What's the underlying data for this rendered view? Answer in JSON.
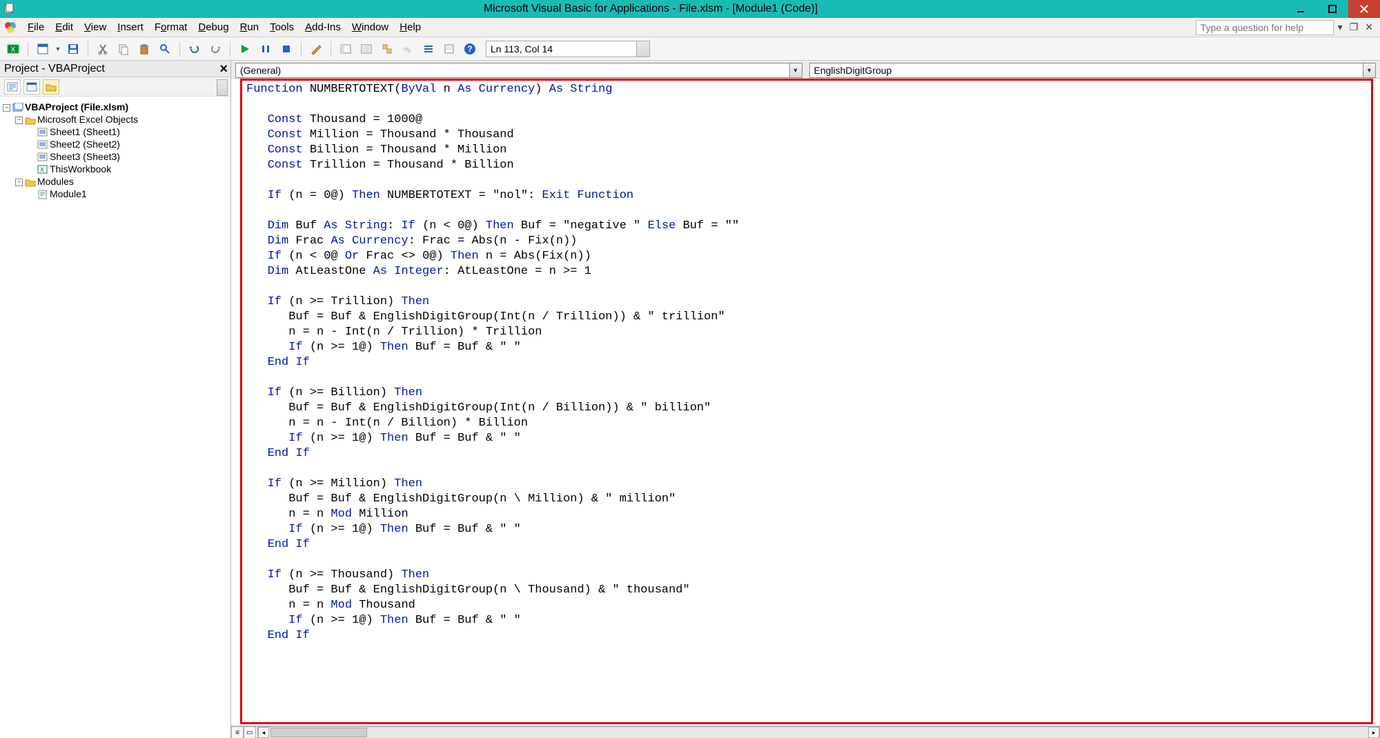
{
  "title": "Microsoft Visual Basic for Applications - File.xlsm - [Module1 (Code)]",
  "menus": {
    "file": "File",
    "edit": "Edit",
    "view": "View",
    "insert": "Insert",
    "format": "Format",
    "debug": "Debug",
    "run": "Run",
    "tools": "Tools",
    "addins": "Add-Ins",
    "window": "Window",
    "help": "Help"
  },
  "help_placeholder": "Type a question for help",
  "cursor_pos": "Ln 113, Col 14",
  "project_header": "Project - VBAProject",
  "tree": {
    "root": "VBAProject (File.xlsm)",
    "excel_objects": "Microsoft Excel Objects",
    "sheets": [
      "Sheet1 (Sheet1)",
      "Sheet2 (Sheet2)",
      "Sheet3 (Sheet3)"
    ],
    "thiswb": "ThisWorkbook",
    "modules_folder": "Modules",
    "module": "Module1"
  },
  "dropdown_left": "(General)",
  "dropdown_right": "EnglishDigitGroup",
  "code_tokens": [
    [
      {
        "t": "Function",
        "k": 1
      },
      {
        "t": " NUMBERTOTEXT("
      },
      {
        "t": "ByVal",
        "k": 1
      },
      {
        "t": " n "
      },
      {
        "t": "As Currency",
        "k": 1
      },
      {
        "t": ") "
      },
      {
        "t": "As String",
        "k": 1
      }
    ],
    [],
    [
      {
        "t": "   "
      },
      {
        "t": "Const",
        "k": 1
      },
      {
        "t": " Thousand = 1000@"
      }
    ],
    [
      {
        "t": "   "
      },
      {
        "t": "Const",
        "k": 1
      },
      {
        "t": " Million = Thousand * Thousand"
      }
    ],
    [
      {
        "t": "   "
      },
      {
        "t": "Const",
        "k": 1
      },
      {
        "t": " Billion = Thousand * Million"
      }
    ],
    [
      {
        "t": "   "
      },
      {
        "t": "Const",
        "k": 1
      },
      {
        "t": " Trillion = Thousand * Billion"
      }
    ],
    [],
    [
      {
        "t": "   "
      },
      {
        "t": "If",
        "k": 1
      },
      {
        "t": " (n = 0@) "
      },
      {
        "t": "Then",
        "k": 1
      },
      {
        "t": " NUMBERTOTEXT = \"nol\": "
      },
      {
        "t": "Exit Function",
        "k": 1
      }
    ],
    [],
    [
      {
        "t": "   "
      },
      {
        "t": "Dim",
        "k": 1
      },
      {
        "t": " Buf "
      },
      {
        "t": "As String",
        "k": 1
      },
      {
        "t": ": "
      },
      {
        "t": "If",
        "k": 1
      },
      {
        "t": " (n < 0@) "
      },
      {
        "t": "Then",
        "k": 1
      },
      {
        "t": " Buf = \"negative \" "
      },
      {
        "t": "Else",
        "k": 1
      },
      {
        "t": " Buf = \"\""
      }
    ],
    [
      {
        "t": "   "
      },
      {
        "t": "Dim",
        "k": 1
      },
      {
        "t": " Frac "
      },
      {
        "t": "As Currency",
        "k": 1
      },
      {
        "t": ": Frac = Abs(n - Fix(n))"
      }
    ],
    [
      {
        "t": "   "
      },
      {
        "t": "If",
        "k": 1
      },
      {
        "t": " (n < 0@ "
      },
      {
        "t": "Or",
        "k": 1
      },
      {
        "t": " Frac <> 0@) "
      },
      {
        "t": "Then",
        "k": 1
      },
      {
        "t": " n = Abs(Fix(n))"
      }
    ],
    [
      {
        "t": "   "
      },
      {
        "t": "Dim",
        "k": 1
      },
      {
        "t": " AtLeastOne "
      },
      {
        "t": "As Integer",
        "k": 1
      },
      {
        "t": ": AtLeastOne = n >= 1"
      }
    ],
    [],
    [
      {
        "t": "   "
      },
      {
        "t": "If",
        "k": 1
      },
      {
        "t": " (n >= Trillion) "
      },
      {
        "t": "Then",
        "k": 1
      }
    ],
    [
      {
        "t": "      Buf = Buf & EnglishDigitGroup(Int(n / Trillion)) & \" trillion\""
      }
    ],
    [
      {
        "t": "      n = n - Int(n / Trillion) * Trillion"
      }
    ],
    [
      {
        "t": "      "
      },
      {
        "t": "If",
        "k": 1
      },
      {
        "t": " (n >= 1@) "
      },
      {
        "t": "Then",
        "k": 1
      },
      {
        "t": " Buf = Buf & \" \""
      }
    ],
    [
      {
        "t": "   "
      },
      {
        "t": "End If",
        "k": 1
      }
    ],
    [],
    [
      {
        "t": "   "
      },
      {
        "t": "If",
        "k": 1
      },
      {
        "t": " (n >= Billion) "
      },
      {
        "t": "Then",
        "k": 1
      }
    ],
    [
      {
        "t": "      Buf = Buf & EnglishDigitGroup(Int(n / Billion)) & \" billion\""
      }
    ],
    [
      {
        "t": "      n = n - Int(n / Billion) * Billion"
      }
    ],
    [
      {
        "t": "      "
      },
      {
        "t": "If",
        "k": 1
      },
      {
        "t": " (n >= 1@) "
      },
      {
        "t": "Then",
        "k": 1
      },
      {
        "t": " Buf = Buf & \" \""
      }
    ],
    [
      {
        "t": "   "
      },
      {
        "t": "End If",
        "k": 1
      }
    ],
    [],
    [
      {
        "t": "   "
      },
      {
        "t": "If",
        "k": 1
      },
      {
        "t": " (n >= Million) "
      },
      {
        "t": "Then",
        "k": 1
      }
    ],
    [
      {
        "t": "      Buf = Buf & EnglishDigitGroup(n \\ Million) & \" million\""
      }
    ],
    [
      {
        "t": "      n = n "
      },
      {
        "t": "Mod",
        "k": 1
      },
      {
        "t": " Million"
      }
    ],
    [
      {
        "t": "      "
      },
      {
        "t": "If",
        "k": 1
      },
      {
        "t": " (n >= 1@) "
      },
      {
        "t": "Then",
        "k": 1
      },
      {
        "t": " Buf = Buf & \" \""
      }
    ],
    [
      {
        "t": "   "
      },
      {
        "t": "End If",
        "k": 1
      }
    ],
    [],
    [
      {
        "t": "   "
      },
      {
        "t": "If",
        "k": 1
      },
      {
        "t": " (n >= Thousand) "
      },
      {
        "t": "Then",
        "k": 1
      }
    ],
    [
      {
        "t": "      Buf = Buf & EnglishDigitGroup(n \\ Thousand) & \" thousand\""
      }
    ],
    [
      {
        "t": "      n = n "
      },
      {
        "t": "Mod",
        "k": 1
      },
      {
        "t": " Thousand"
      }
    ],
    [
      {
        "t": "      "
      },
      {
        "t": "If",
        "k": 1
      },
      {
        "t": " (n >= 1@) "
      },
      {
        "t": "Then",
        "k": 1
      },
      {
        "t": " Buf = Buf & \" \""
      }
    ],
    [
      {
        "t": "   "
      },
      {
        "t": "End If",
        "k": 1
      }
    ],
    []
  ]
}
